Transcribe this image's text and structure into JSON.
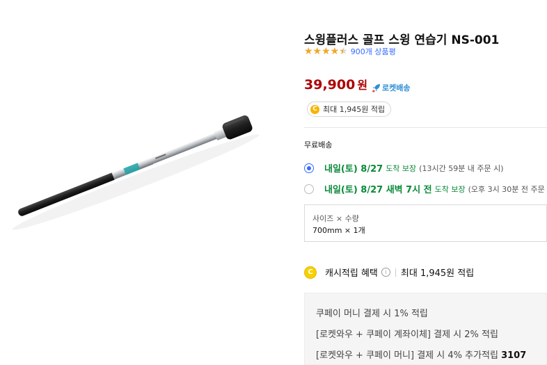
{
  "product": {
    "title": "스윙플러스 골프 스윙 연습기 NS-001",
    "rating_fraction": 0.9,
    "stars": "★★★★★",
    "review_count": "900개 상품평",
    "price": "39,900",
    "currency": "원",
    "rocket_label": "로켓배송",
    "reward_coin": "C",
    "reward_text": "최대 1,945원 적립"
  },
  "shipping": {
    "title": "무료배송",
    "options": [
      {
        "date": "내일(토) 8/27",
        "guarantee": "도착 보장",
        "note": "(13시간 59분 내 주문 시)",
        "checked": true
      },
      {
        "date": "내일(토) 8/27 새벽 7시 전",
        "guarantee": "도착 보장",
        "note": "(오후 3시 30분 전 주문",
        "checked": false
      }
    ]
  },
  "selected_option": {
    "label": "사이즈 × 수량",
    "value": "700mm × 1개"
  },
  "cash_reward": {
    "coin": "C",
    "label": "캐시적립 혜택",
    "info_glyph": "i",
    "max": "최대 1,945원 적립"
  },
  "benefits": [
    {
      "text": "쿠페이 머니 결제 시 1% 적립",
      "bold": ""
    },
    {
      "text": "[로켓와우 + 쿠페이 계좌이체] 결제 시 2% 적립",
      "bold": ""
    },
    {
      "text": "[로켓와우 + 쿠페이 머니] 결제 시 4% 추가적립 ",
      "bold": "3107"
    }
  ],
  "colors": {
    "price": "#ae0000",
    "accent": "#346aff",
    "arrival": "#0a8a3a",
    "star": "#f5a623"
  }
}
